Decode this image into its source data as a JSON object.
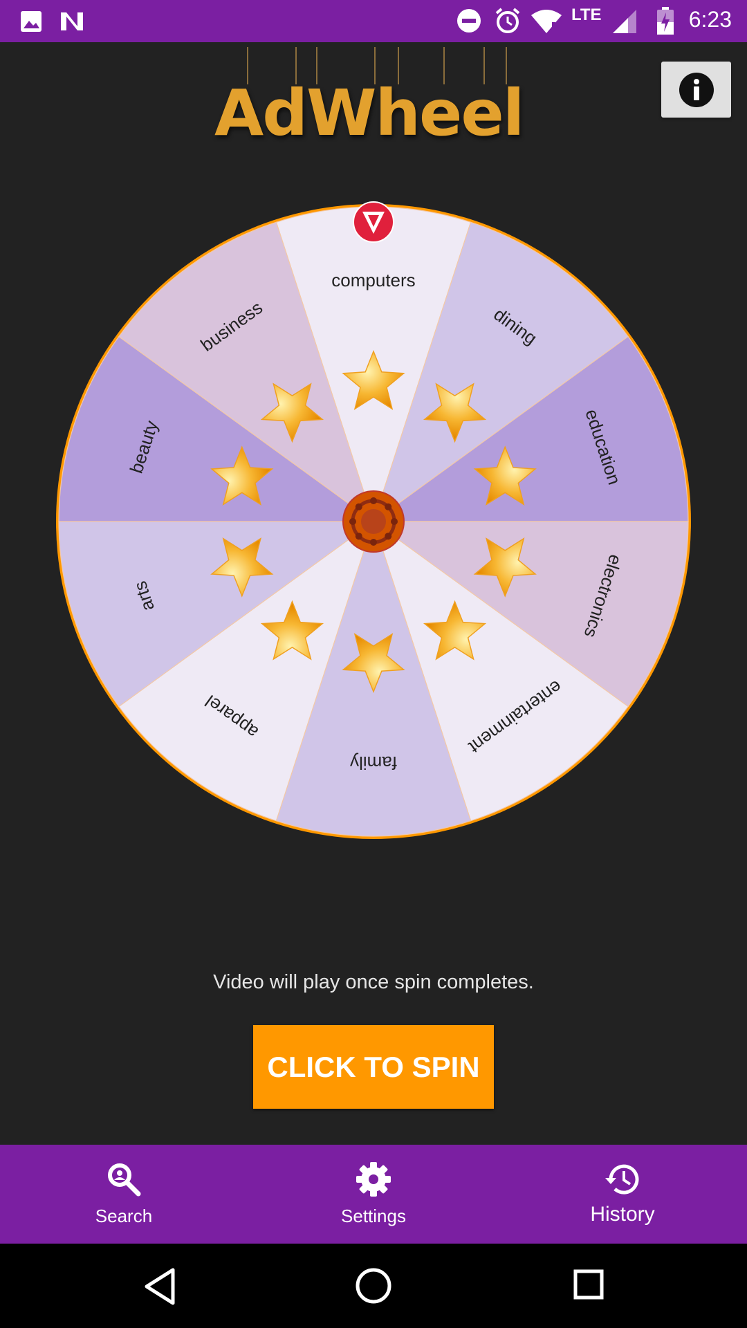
{
  "status_bar": {
    "time": "6:23",
    "network": "LTE",
    "icons": [
      "image-icon",
      "n-logo-icon",
      "do-not-disturb-icon",
      "alarm-icon",
      "wifi-icon",
      "signal-icon",
      "battery-charging-icon"
    ]
  },
  "header": {
    "logo_text": "AdWheel",
    "info_icon": "info-icon"
  },
  "wheel": {
    "segments": [
      {
        "label": "computers",
        "color": "#efeaf5"
      },
      {
        "label": "dining",
        "color": "#d0c5e8"
      },
      {
        "label": "education",
        "color": "#b39ddb"
      },
      {
        "label": "electronics",
        "color": "#d9c3dc"
      },
      {
        "label": "entertainment",
        "color": "#efeaf5"
      },
      {
        "label": "family",
        "color": "#d0c5e8"
      },
      {
        "label": "apparel",
        "color": "#efeaf5"
      },
      {
        "label": "arts",
        "color": "#d0c5e8"
      },
      {
        "label": "beauty",
        "color": "#b39ddb"
      },
      {
        "label": "business",
        "color": "#d9c3dc"
      }
    ],
    "rim_color": "#ff9800",
    "pointer_color": "#e0203c",
    "hub_color": "#d35400"
  },
  "caption": "Video will play once spin completes.",
  "spin_button_label": "CLICK TO SPIN",
  "bottom_nav": {
    "items": [
      {
        "label": "Search",
        "icon": "search-icon"
      },
      {
        "label": "Settings",
        "icon": "settings-icon"
      },
      {
        "label": "History",
        "icon": "history-icon"
      }
    ],
    "active": "History"
  },
  "system_nav": [
    "back-icon",
    "home-icon",
    "recents-icon"
  ]
}
